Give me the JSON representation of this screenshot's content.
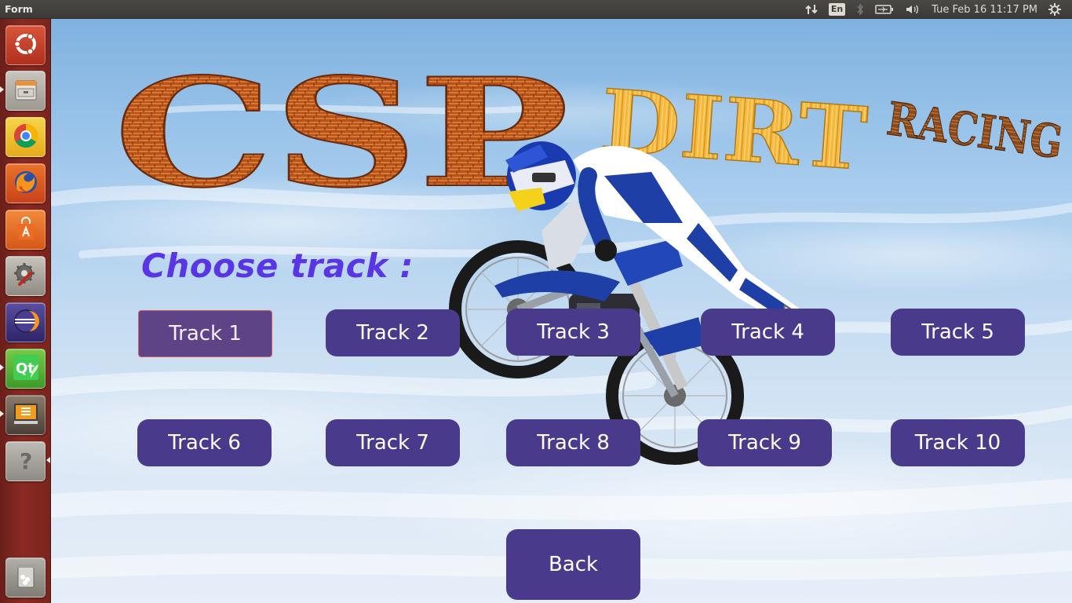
{
  "window": {
    "title": "Form"
  },
  "tray": {
    "keyboard_layout": "En",
    "datetime": "Tue Feb 16 11:17 PM"
  },
  "launcher": {
    "items": [
      {
        "name": "ubuntu-dash",
        "icon": "ubuntu-logo-icon"
      },
      {
        "name": "files",
        "icon": "file-cabinet-icon"
      },
      {
        "name": "chrome",
        "icon": "chrome-icon"
      },
      {
        "name": "firefox",
        "icon": "firefox-icon"
      },
      {
        "name": "software-center",
        "icon": "shopping-bag-icon"
      },
      {
        "name": "system-settings",
        "icon": "settings-wrench-icon"
      },
      {
        "name": "eclipse",
        "icon": "eclipse-icon"
      },
      {
        "name": "qt-creator",
        "icon": "qt-icon"
      },
      {
        "name": "sublime-text",
        "icon": "sublime-icon"
      },
      {
        "name": "unknown-app",
        "icon": "question-mark-icon"
      },
      {
        "name": "trash",
        "icon": "trash-icon"
      }
    ]
  },
  "logo": {
    "big": "CSP",
    "mid": "DIRT",
    "small": "RACING",
    "colors": {
      "wood": "#b8511c",
      "yellow": "#f6b73a",
      "brown": "#8a4a1e"
    }
  },
  "heading": "Choose track :",
  "tracks": [
    {
      "label": "Track 1",
      "selected": true
    },
    {
      "label": "Track 2",
      "selected": false
    },
    {
      "label": "Track 3",
      "selected": false
    },
    {
      "label": "Track 4",
      "selected": false
    },
    {
      "label": "Track 5",
      "selected": false
    },
    {
      "label": "Track 6",
      "selected": false
    },
    {
      "label": "Track 7",
      "selected": false
    },
    {
      "label": "Track 8",
      "selected": false
    },
    {
      "label": "Track 9",
      "selected": false
    },
    {
      "label": "Track 10",
      "selected": false
    }
  ],
  "back_label": "Back",
  "colors": {
    "button": "#4a3a8c",
    "heading": "#5a35e6",
    "launcher": "#7b241e"
  }
}
